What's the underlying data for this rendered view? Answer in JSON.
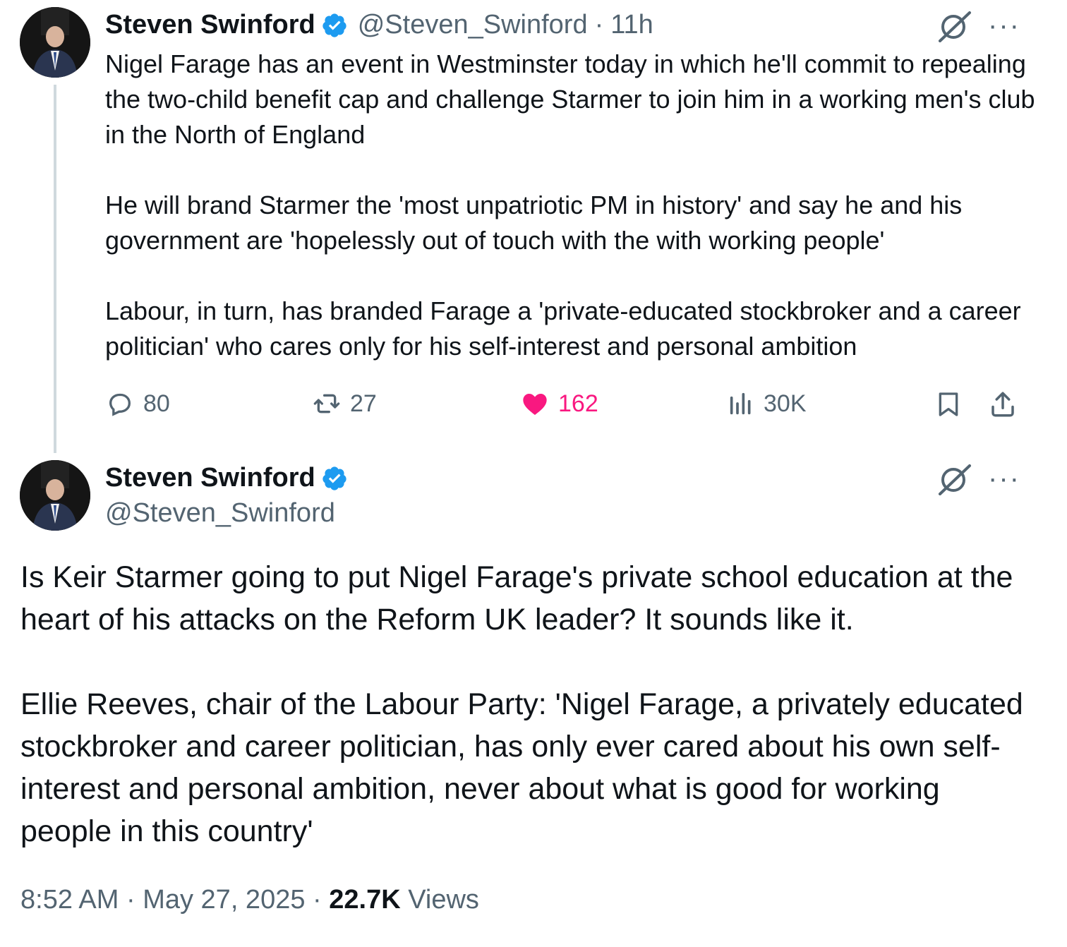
{
  "first_tweet": {
    "author_name": "Steven Swinford",
    "handle": "@Steven_Swinford",
    "separator": "·",
    "time_ago": "11h",
    "paragraphs": [
      "Nigel Farage has an event in Westminster today in which he'll commit to repealing the two-child benefit cap and challenge Starmer to join him in a working men's club in the North of England",
      "He will brand Starmer the 'most unpatriotic PM in history' and say he and his government are 'hopelessly out of touch with the with working people'",
      "Labour, in turn, has branded Farage a 'private-educated stockbroker and a career politician' who cares only for his self-interest and personal ambition"
    ],
    "stats": {
      "replies": "80",
      "reposts": "27",
      "likes": "162",
      "views": "30K"
    }
  },
  "second_tweet": {
    "author_name": "Steven Swinford",
    "handle": "@Steven_Swinford",
    "paragraphs": [
      "Is Keir Starmer going to put Nigel Farage's private school education at the heart of his attacks on the Reform UK leader? It sounds like it.",
      "Ellie Reeves, chair of the Labour Party: 'Nigel Farage, a privately educated stockbroker and career politician, has only ever cared about his own self-interest and personal ambition, never about what is good for working people in this country'"
    ],
    "time": "8:52 AM",
    "date": "May 27, 2025",
    "separator": "·",
    "views_count": "22.7K",
    "views_label": "Views"
  },
  "more_glyph": "···",
  "colors": {
    "verified": "#1d9bf0",
    "like": "#f91880",
    "muted": "#536471",
    "text": "#0f1419",
    "thread_line": "#cfd9de"
  },
  "icons": [
    "grok-icon",
    "more-icon",
    "reply-icon",
    "repost-icon",
    "like-icon",
    "views-icon",
    "bookmark-icon",
    "share-icon",
    "verified-badge-icon"
  ]
}
